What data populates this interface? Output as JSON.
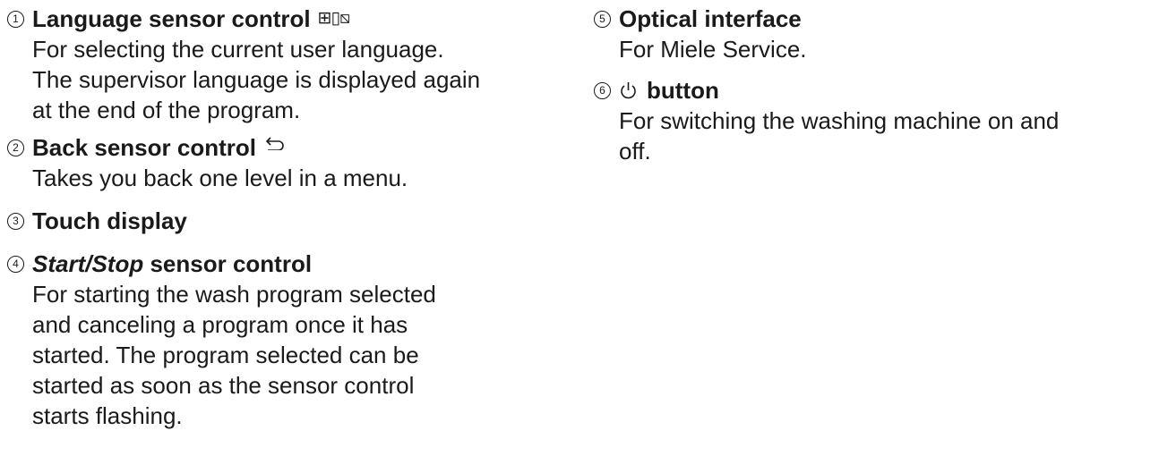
{
  "left_column": [
    {
      "number": "1",
      "title": "Language sensor control",
      "icon": "flags-icon",
      "description": [
        "For selecting the current user language.",
        "The supervisor language is displayed again",
        "at the end of the program."
      ]
    },
    {
      "number": "2",
      "title": "Back sensor control",
      "icon": "back-arrow-icon",
      "description": [
        "Takes you back one level in a menu."
      ]
    },
    {
      "number": "3",
      "title": "Touch display",
      "description": []
    },
    {
      "number": "4",
      "title_italic": "Start/Stop",
      "title_rest": " sensor control",
      "description": [
        "For starting the wash program selected",
        "and canceling a program once it has",
        "started. The program selected can be",
        "started as soon as the sensor control",
        "starts flashing."
      ]
    }
  ],
  "right_column": [
    {
      "number": "5",
      "title": "Optical interface",
      "description": [
        "For Miele Service."
      ]
    },
    {
      "number": "6",
      "icon": "power-icon",
      "title": "button",
      "description": [
        "For switching the washing machine on and",
        "off."
      ]
    }
  ]
}
